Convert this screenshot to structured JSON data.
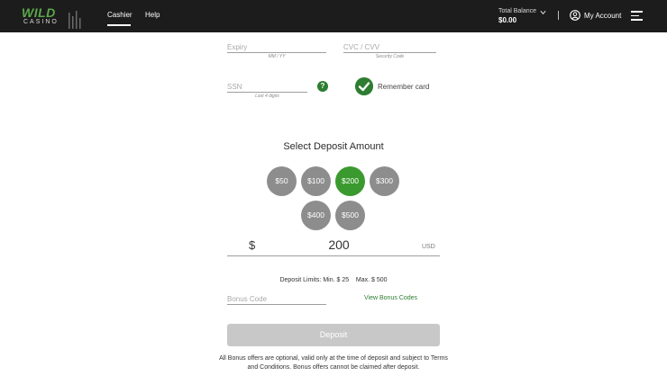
{
  "header": {
    "logo_top": "WILD",
    "logo_bottom": "CASINO",
    "nav": {
      "cashier": "Cashier",
      "help": "Help"
    },
    "balance_label": "Total Balance",
    "balance_value": "$0.00",
    "separator": "|",
    "account_label": "My Account"
  },
  "card_form": {
    "expiry_placeholder": "Expiry",
    "expiry_helper": "MM / YY",
    "cvc_placeholder": "CVC / CVV",
    "cvc_helper": "Security Code",
    "ssn_placeholder": "SSN",
    "ssn_helper": "Last 4 digits",
    "help_symbol": "?",
    "remember_label": "Remember card",
    "remember_checked": true
  },
  "deposit": {
    "title": "Select Deposit Amount",
    "amounts": [
      "$50",
      "$100",
      "$200",
      "$300",
      "$400",
      "$500"
    ],
    "selected": "$200",
    "currency_symbol": "$",
    "amount_value": "200",
    "currency_code": "USD",
    "limits": "Deposit Limits: Min. $ 25    Max. $ 500",
    "bonus_placeholder": "Bonus Code",
    "bonus_link": "View Bonus Codes",
    "submit_label": "Deposit",
    "terms": "All Bonus offers are optional, valid only at the time of deposit and subject to Terms and Conditions. Bonus offers cannot be claimed after deposit."
  },
  "colors": {
    "header_bg": "#1c1c1c",
    "brand_green": "#3b9a2f",
    "dark_green": "#2e7d32",
    "amount_grey": "#8d8d8d",
    "button_disabled": "#c8c8c8"
  },
  "icons": {
    "account": "account-circle-icon",
    "menu": "hamburger-menu-icon",
    "chevron": "chevron-down-icon",
    "help": "help-circle-icon",
    "check": "check-circle-icon"
  }
}
